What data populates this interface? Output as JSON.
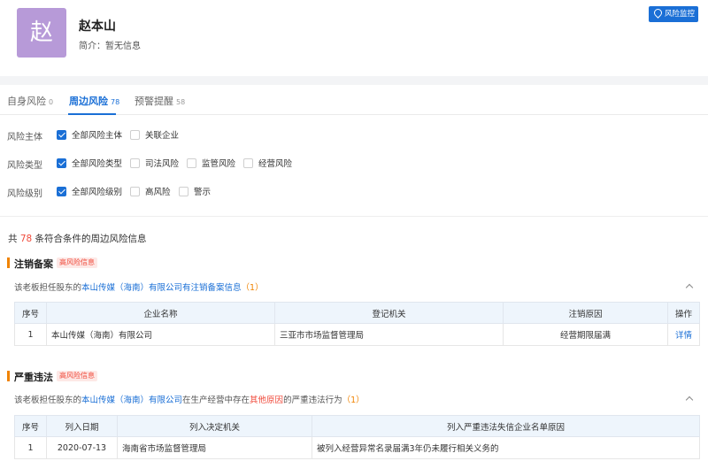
{
  "profile": {
    "avatar_char": "赵",
    "name": "赵本山",
    "intro_label": "简介：",
    "intro_value": "暂无信息",
    "monitor_button": "风险监控"
  },
  "tabs": [
    {
      "label": "自身风险",
      "count": "0"
    },
    {
      "label": "周边风险",
      "count": "78"
    },
    {
      "label": "预警提醒",
      "count": "58"
    }
  ],
  "filters": [
    {
      "label": "风险主体",
      "options": [
        {
          "text": "全部风险主体",
          "checked": true
        },
        {
          "text": "关联企业",
          "checked": false
        }
      ]
    },
    {
      "label": "风险类型",
      "options": [
        {
          "text": "全部风险类型",
          "checked": true
        },
        {
          "text": "司法风险",
          "checked": false
        },
        {
          "text": "监管风险",
          "checked": false
        },
        {
          "text": "经营风险",
          "checked": false
        }
      ]
    },
    {
      "label": "风险级别",
      "options": [
        {
          "text": "全部风险级别",
          "checked": true
        },
        {
          "text": "高风险",
          "checked": false
        },
        {
          "text": "警示",
          "checked": false
        }
      ]
    }
  ],
  "summary": {
    "prefix": "共 ",
    "count": "78",
    "suffix": " 条符合条件的周边风险信息"
  },
  "section1": {
    "title": "注销备案",
    "badge": "高风险信息",
    "desc_prefix": "该老板担任股东的",
    "desc_company": "本山传媒（海南）有限公司",
    "desc_event": "有注销备案信息",
    "desc_count": "（1）",
    "headers": [
      "序号",
      "企业名称",
      "登记机关",
      "注销原因",
      "操作"
    ],
    "rows": [
      {
        "no": "1",
        "company": "本山传媒（海南）有限公司",
        "authority": "三亚市市场监督管理局",
        "reason": "经营期限届满",
        "action": "详情"
      }
    ]
  },
  "section2": {
    "title": "严重违法",
    "badge": "高风险信息",
    "desc_prefix": "该老板担任股东的",
    "desc_company": "本山传媒（海南）有限公司",
    "desc_mid": "在生产经营中存在",
    "desc_reason": "其他原因",
    "desc_suffix": "的严重违法行为",
    "desc_count": "（1）",
    "headers": [
      "序号",
      "列入日期",
      "列入决定机关",
      "列入严重违法失信企业名单原因"
    ],
    "rows": [
      {
        "no": "1",
        "date": "2020-07-13",
        "authority": "海南省市场监督管理局",
        "reason": "被列入经营异常名录届满3年仍未履行相关义务的"
      }
    ]
  },
  "colors": {
    "accent": "#1a6fd6",
    "danger": "#f04b3c",
    "section_bar": "#f08300",
    "avatar_bg": "#b79ad8"
  }
}
